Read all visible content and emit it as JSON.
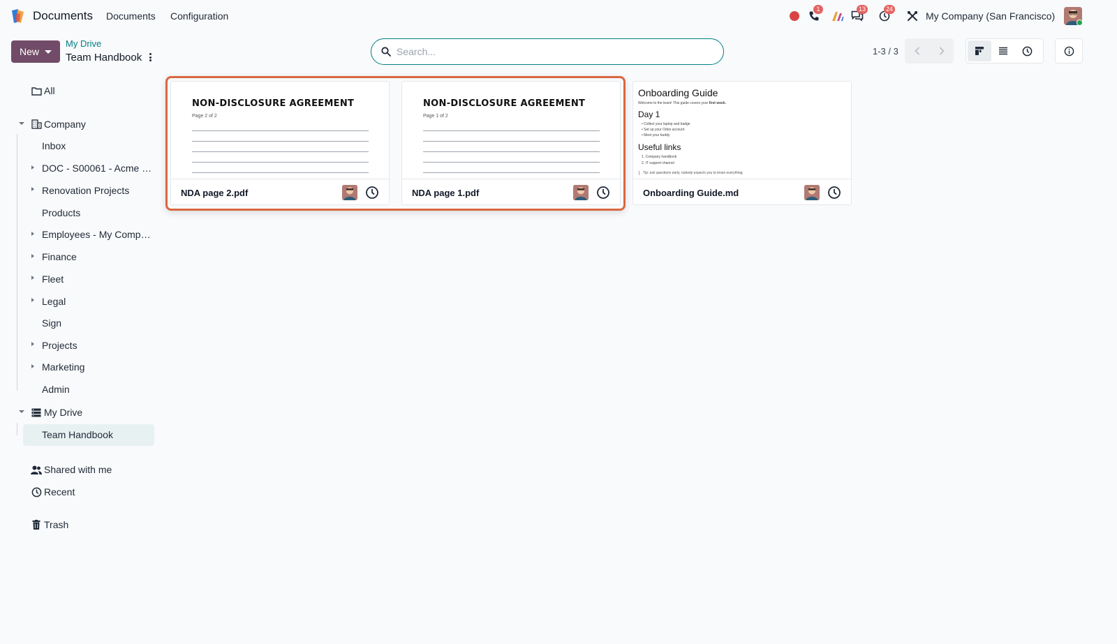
{
  "navbar": {
    "app_name": "Documents",
    "menu": [
      "Documents",
      "Configuration"
    ],
    "badges": {
      "phone": "1",
      "messages": "13",
      "activities": "24"
    },
    "company": "My Company (San Francisco)"
  },
  "control_panel": {
    "new_label": "New",
    "breadcrumb_parent": "My Drive",
    "breadcrumb_current": "Team Handbook",
    "search_placeholder": "Search...",
    "pager": "1-3 / 3"
  },
  "sidebar": {
    "all": "All",
    "company": "Company",
    "company_children": [
      "Inbox",
      "DOC - S00061 - Acme …",
      "Renovation Projects",
      "Products",
      "Employees - My Comp…",
      "Finance",
      "Fleet",
      "Legal",
      "Sign",
      "Projects",
      "Marketing",
      "Admin"
    ],
    "my_drive": "My Drive",
    "team_handbook": "Team Handbook",
    "shared": "Shared with me",
    "recent": "Recent",
    "trash": "Trash"
  },
  "documents": [
    {
      "name": "NDA page 2.pdf",
      "preview_title": "NON-DISCLOSURE AGREEMENT",
      "preview_sub": "Page 2 of 2"
    },
    {
      "name": "NDA page 1.pdf",
      "preview_title": "NON-DISCLOSURE AGREEMENT",
      "preview_sub": "Page 1 of 2"
    },
    {
      "name": "Onboarding Guide.md",
      "preview_title": "Onboarding Guide",
      "intro_text": "Welcome to the team! This guide covers your ",
      "intro_bold": "first week.",
      "h_day1": "Day 1",
      "day1_items": [
        "Collect your laptop and badge",
        "Set up your Odoo account",
        "Meet your buddy"
      ],
      "h_links": "Useful links",
      "links": [
        "1. Company handbook",
        "2. IT support channel"
      ],
      "tip": "Tip: ask questions early, nobody expects you to know everything."
    }
  ],
  "colors": {
    "brand": "#714b67",
    "accent": "#017e84",
    "selection": "#d9673f",
    "badge": "#e46363",
    "record": "#d94343"
  }
}
